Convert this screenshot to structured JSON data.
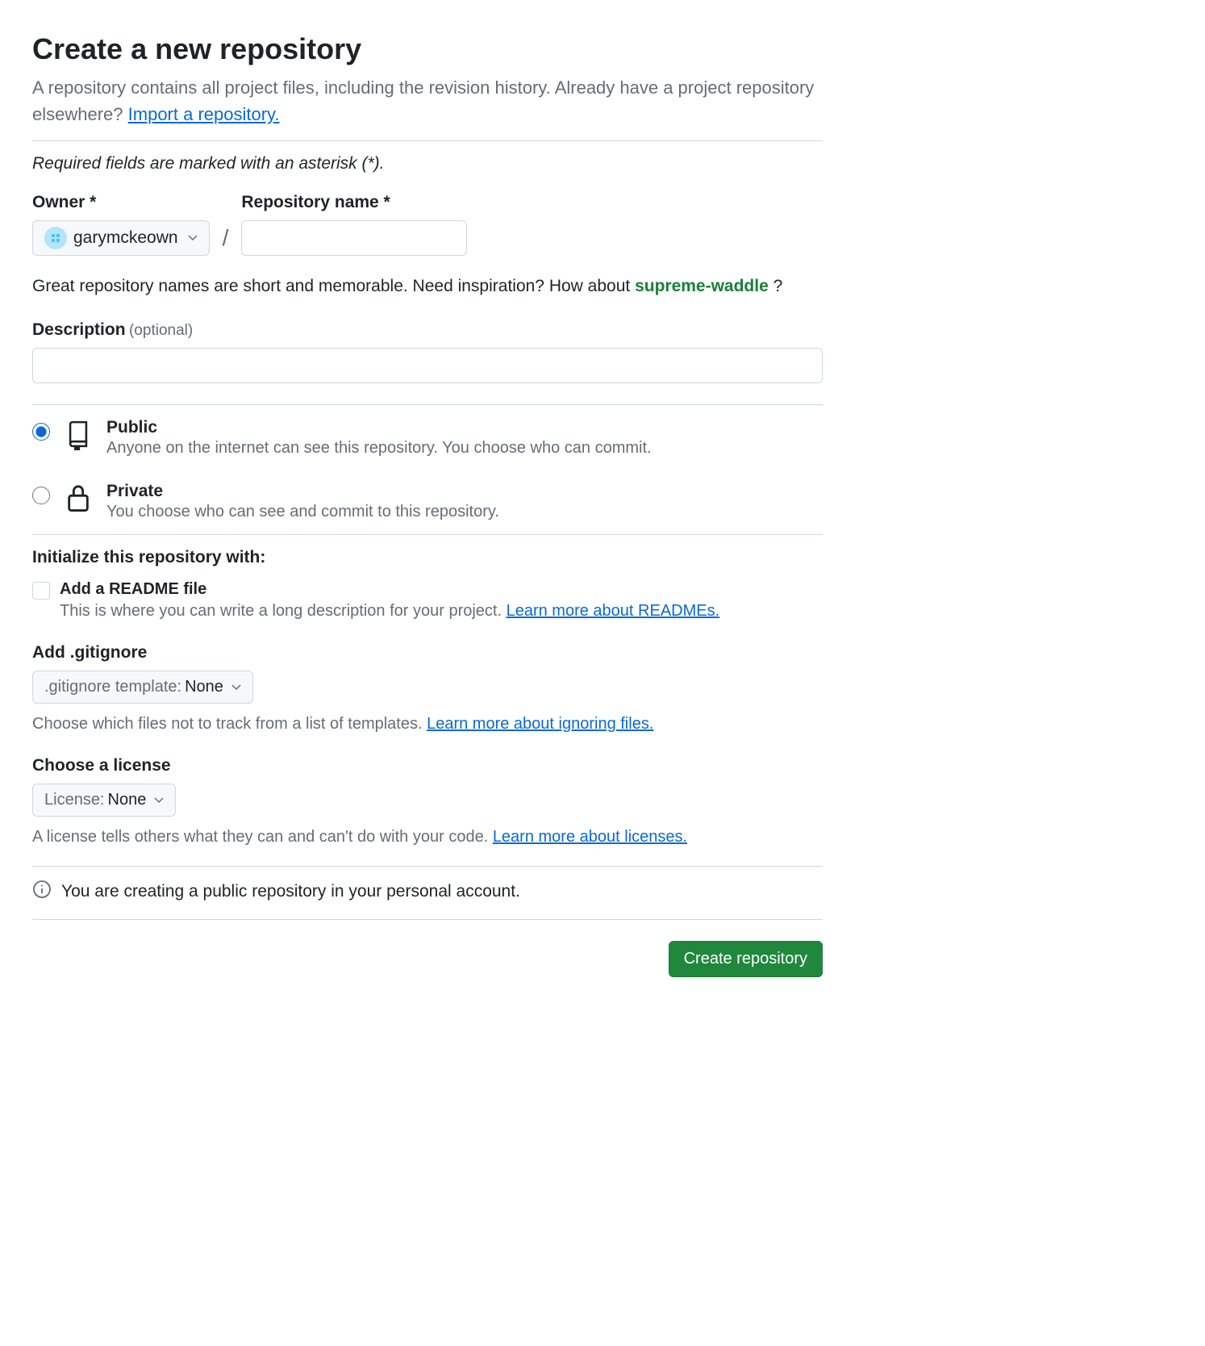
{
  "header": {
    "title": "Create a new repository",
    "subtitle_text": "A repository contains all project files, including the revision history. Already have a project repository elsewhere? ",
    "import_link": "Import a repository."
  },
  "required_note": "Required fields are marked with an asterisk (*).",
  "owner": {
    "label": "Owner *",
    "selected": "garymckeown"
  },
  "repo_name": {
    "label": "Repository name *",
    "value": ""
  },
  "suggestion": {
    "prefix": "Great repository names are short and memorable. Need inspiration? How about ",
    "name": "supreme-waddle",
    "suffix": " ?"
  },
  "description": {
    "label": "Description",
    "optional": "(optional)",
    "value": ""
  },
  "visibility": {
    "public": {
      "title": "Public",
      "desc": "Anyone on the internet can see this repository. You choose who can commit."
    },
    "private": {
      "title": "Private",
      "desc": "You choose who can see and commit to this repository."
    }
  },
  "init": {
    "heading": "Initialize this repository with:",
    "readme": {
      "title": "Add a README file",
      "hint_text": "This is where you can write a long description for your project. ",
      "hint_link": "Learn more about READMEs."
    },
    "gitignore": {
      "label": "Add .gitignore",
      "selector_prefix": ".gitignore template:",
      "selector_value": "None",
      "hint_text": "Choose which files not to track from a list of templates. ",
      "hint_link": "Learn more about ignoring files."
    },
    "license": {
      "label": "Choose a license",
      "selector_prefix": "License:",
      "selector_value": "None",
      "hint_text": "A license tells others what they can and can't do with your code. ",
      "hint_link": "Learn more about licenses."
    }
  },
  "info_notice": "You are creating a public repository in your personal account.",
  "submit_label": "Create repository"
}
